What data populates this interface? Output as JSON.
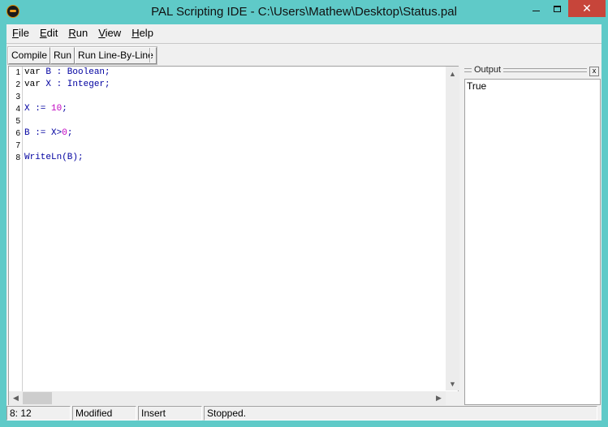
{
  "window": {
    "title": "PAL Scripting IDE - C:\\Users\\Mathew\\Desktop\\Status.pal",
    "minimize_label": "",
    "close_label": "✕"
  },
  "menubar": {
    "items": [
      {
        "accel": "F",
        "rest": "ile"
      },
      {
        "accel": "E",
        "rest": "dit"
      },
      {
        "accel": "R",
        "rest": "un"
      },
      {
        "accel": "V",
        "rest": "iew"
      },
      {
        "accel": "H",
        "rest": "elp"
      }
    ]
  },
  "toolbar": {
    "compile_label": "Compile",
    "run_label": "Run",
    "run_line_label": "Run Line-By-Line"
  },
  "editor": {
    "lines": [
      {
        "n": "1",
        "parts": [
          {
            "t": "var ",
            "c": "kw"
          },
          {
            "t": "B : Boolean;",
            "c": "id"
          }
        ]
      },
      {
        "n": "2",
        "parts": [
          {
            "t": "var ",
            "c": "kw"
          },
          {
            "t": "X : Integer;",
            "c": "id"
          }
        ]
      },
      {
        "n": "3",
        "parts": []
      },
      {
        "n": "4",
        "parts": [
          {
            "t": "X := ",
            "c": "id"
          },
          {
            "t": "10",
            "c": "num"
          },
          {
            "t": ";",
            "c": "id"
          }
        ]
      },
      {
        "n": "5",
        "parts": []
      },
      {
        "n": "6",
        "parts": [
          {
            "t": "B := X>",
            "c": "id"
          },
          {
            "t": "0",
            "c": "num"
          },
          {
            "t": ";",
            "c": "id"
          }
        ]
      },
      {
        "n": "7",
        "parts": []
      },
      {
        "n": "8",
        "parts": [
          {
            "t": "WriteLn(B);",
            "c": "id"
          }
        ]
      }
    ],
    "scroll_up": "▲",
    "scroll_down": "▼",
    "scroll_left": "◀",
    "scroll_right": "▶"
  },
  "output": {
    "title": "Output",
    "close_label": "x",
    "text": "True"
  },
  "statusbar": {
    "position": "8: 12",
    "modified": "Modified",
    "mode": "Insert",
    "state": "Stopped."
  }
}
